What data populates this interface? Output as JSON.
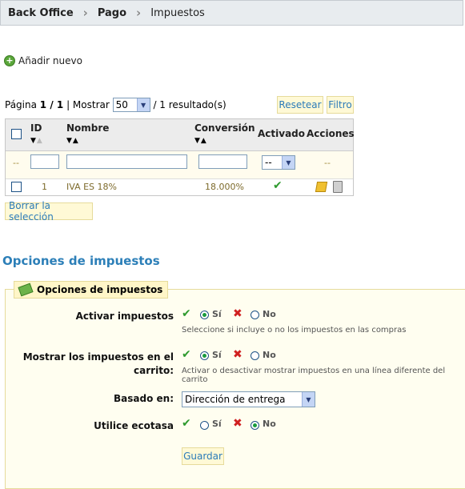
{
  "breadcrumb": {
    "items": [
      "Back Office",
      "Pago",
      "Impuestos"
    ]
  },
  "add_new": "Añadir nuevo",
  "pagination": {
    "pagina_label": "Página",
    "page": "1 / 1",
    "mostrar_label": "| Mostrar",
    "per_page": "50",
    "results": "/ 1 resultado(s)"
  },
  "buttons": {
    "reset": "Resetear",
    "filter": "Filtro",
    "delete_selection": "Borrar la selección",
    "save": "Guardar"
  },
  "table": {
    "columns": {
      "id": "ID",
      "nombre": "Nombre",
      "conversion": "Conversión",
      "activado": "Activado",
      "acciones": "Acciones"
    },
    "filter": {
      "placeholder_dash": "--",
      "activado_select": "--",
      "acciones_dash": "--"
    },
    "rows": [
      {
        "id": "1",
        "nombre": "IVA ES 18%",
        "conversion": "18.000%",
        "activado": true
      }
    ]
  },
  "section_title": "Opciones de impuestos",
  "legend": "Opciones de impuestos",
  "options": {
    "activar": {
      "label": "Activar impuestos",
      "yes": "Sí",
      "no": "No",
      "selected": "yes",
      "hint": "Seleccione si incluye o no los impuestos en las compras"
    },
    "mostrar": {
      "label_line1": "Mostrar los impuestos en el",
      "label_line2": "carrito:",
      "yes": "Sí",
      "no": "No",
      "selected": "yes",
      "hint": "Activar o desactivar mostrar impuestos en una línea diferente del carrito"
    },
    "basado": {
      "label": "Basado en:",
      "value": "Dirección de entrega"
    },
    "ecotasa": {
      "label": "Utilice ecotasa",
      "yes": "Sí",
      "no": "No",
      "selected": "no"
    }
  },
  "colors": {
    "accent": "#2c7fb8",
    "button_bg": "#fff9d6",
    "fieldset_bg": "#fffef0"
  },
  "icons": {
    "add": "plus-circle-icon",
    "enabled": "check-icon",
    "edit": "pencil-icon",
    "delete": "trash-icon",
    "yes": "check-icon",
    "no": "cross-icon"
  }
}
